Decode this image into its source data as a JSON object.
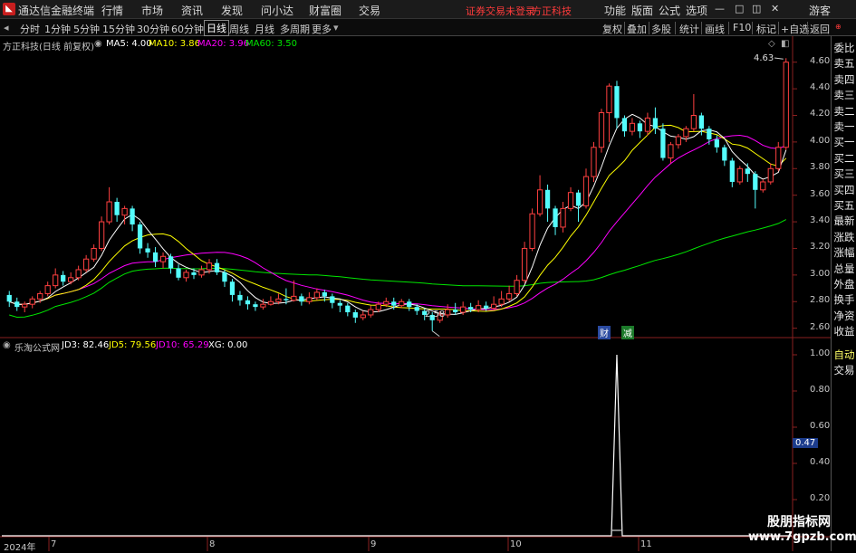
{
  "titlebar": {
    "app_name": "通达信金融终端",
    "menus": [
      "行情",
      "市场",
      "资讯",
      "发现",
      "问小达",
      "财富圈",
      "交易"
    ],
    "warning": "证券交易未登录",
    "broker": "方正科技",
    "right_menus": [
      "功能",
      "版面",
      "公式",
      "选项"
    ],
    "guest": "游客"
  },
  "periodbar": {
    "periods": [
      "分时",
      "1分钟",
      "5分钟",
      "15分钟",
      "30分钟",
      "60分钟",
      "日线",
      "周线",
      "月线",
      "多周期",
      "更多"
    ],
    "active": "日线",
    "tools": [
      "复权",
      "叠加",
      "多股",
      "统计",
      "画线",
      "F10",
      "标记",
      "+自选",
      "返回"
    ]
  },
  "main_legend": {
    "stock": "方正科技(日线 前复权)",
    "ma5": "MA5: 4.00",
    "ma10": "MA10: 3.86",
    "ma20": "MA20: 3.96",
    "ma60": "MA60: 3.50"
  },
  "sub_legend": {
    "name": "乐淘公式网",
    "jd3": "JD3: 82.46",
    "jd5": "JD5: 79.56",
    "jd10": "JD10: 65.29",
    "xg": "XG: 0.00"
  },
  "price_axis": [
    "4.60",
    "4.40",
    "4.20",
    "4.00",
    "3.80",
    "3.60",
    "3.40",
    "3.20",
    "3.00",
    "2.80",
    "2.60"
  ],
  "sub_axis": [
    "1.00",
    "0.80",
    "0.60",
    "0.40",
    "0.20"
  ],
  "sub_cursor_value": "0.47",
  "annotations": {
    "high": "4.63",
    "low": "2.58",
    "cai": "财",
    "jian": "减"
  },
  "date_axis": [
    "2024年",
    "7",
    "8",
    "9",
    "10",
    "11"
  ],
  "right_panel": [
    "委比",
    "卖五",
    "卖四",
    "卖三",
    "卖二",
    "卖一",
    "买一",
    "买二",
    "买三",
    "买四",
    "买五",
    "最新",
    "涨跌",
    "涨幅",
    "总量",
    "外盘",
    "换手",
    "净资",
    "收益"
  ],
  "right_bottom": [
    "自动",
    "交易"
  ],
  "watermark": {
    "cn": "股朋指标网",
    "url": "www.7gpzb.com"
  },
  "colors": {
    "up": "#ff4040",
    "down": "#54fcfc",
    "ma5": "#ffffff",
    "ma10": "#ffff00",
    "ma20": "#ff00ff",
    "ma60": "#00e600",
    "jd_line": "#ffffff"
  },
  "chart_data": {
    "type": "candlestick",
    "y_range": [
      2.55,
      4.7
    ],
    "candles": [
      [
        2.85,
        2.8,
        2.88,
        2.76
      ],
      [
        2.8,
        2.76,
        2.83,
        2.73
      ],
      [
        2.76,
        2.78,
        2.8,
        2.72
      ],
      [
        2.78,
        2.82,
        2.84,
        2.75
      ],
      [
        2.82,
        2.86,
        2.88,
        2.79
      ],
      [
        2.86,
        2.92,
        2.95,
        2.84
      ],
      [
        2.92,
        3.0,
        3.05,
        2.9
      ],
      [
        3.0,
        2.95,
        3.03,
        2.92
      ],
      [
        2.95,
        2.98,
        3.02,
        2.93
      ],
      [
        2.98,
        3.04,
        3.07,
        2.96
      ],
      [
        3.04,
        3.12,
        3.15,
        3.02
      ],
      [
        3.12,
        3.2,
        3.23,
        3.1
      ],
      [
        3.2,
        3.4,
        3.44,
        3.18
      ],
      [
        3.4,
        3.55,
        3.66,
        3.38
      ],
      [
        3.55,
        3.45,
        3.58,
        3.4
      ],
      [
        3.45,
        3.5,
        3.52,
        3.38
      ],
      [
        3.5,
        3.38,
        3.52,
        3.33
      ],
      [
        3.38,
        3.2,
        3.4,
        3.16
      ],
      [
        3.2,
        3.17,
        3.24,
        3.13
      ],
      [
        3.17,
        3.1,
        3.21,
        3.06
      ],
      [
        3.1,
        3.14,
        3.17,
        3.05
      ],
      [
        3.14,
        3.05,
        3.16,
        3.01
      ],
      [
        3.05,
        2.98,
        3.08,
        2.96
      ],
      [
        2.98,
        3.02,
        3.04,
        2.95
      ],
      [
        3.02,
        3.0,
        3.05,
        2.97
      ],
      [
        3.0,
        3.04,
        3.07,
        2.98
      ],
      [
        3.04,
        3.09,
        3.12,
        3.01
      ],
      [
        3.09,
        3.02,
        3.12,
        3.0
      ],
      [
        3.02,
        2.95,
        3.04,
        2.91
      ],
      [
        2.95,
        2.85,
        2.97,
        2.8
      ],
      [
        2.85,
        2.81,
        2.88,
        2.77
      ],
      [
        2.81,
        2.78,
        2.84,
        2.74
      ],
      [
        2.78,
        2.76,
        2.8,
        2.73
      ],
      [
        2.76,
        2.78,
        2.82,
        2.74
      ],
      [
        2.78,
        2.8,
        2.84,
        2.77
      ],
      [
        2.8,
        2.82,
        2.86,
        2.78
      ],
      [
        2.82,
        2.81,
        2.9,
        2.78
      ],
      [
        2.81,
        2.84,
        2.96,
        2.8
      ],
      [
        2.84,
        2.8,
        2.86,
        2.77
      ],
      [
        2.8,
        2.83,
        2.87,
        2.78
      ],
      [
        2.83,
        2.87,
        2.9,
        2.81
      ],
      [
        2.87,
        2.84,
        2.89,
        2.8
      ],
      [
        2.84,
        2.79,
        2.86,
        2.75
      ],
      [
        2.79,
        2.77,
        2.81,
        2.72
      ],
      [
        2.77,
        2.72,
        2.79,
        2.69
      ],
      [
        2.72,
        2.68,
        2.74,
        2.64
      ],
      [
        2.68,
        2.7,
        2.73,
        2.66
      ],
      [
        2.7,
        2.74,
        2.77,
        2.68
      ],
      [
        2.74,
        2.78,
        2.8,
        2.72
      ],
      [
        2.78,
        2.8,
        2.83,
        2.76
      ],
      [
        2.8,
        2.77,
        2.83,
        2.74
      ],
      [
        2.77,
        2.8,
        2.82,
        2.75
      ],
      [
        2.8,
        2.76,
        2.82,
        2.73
      ],
      [
        2.76,
        2.73,
        2.78,
        2.7
      ],
      [
        2.73,
        2.7,
        2.75,
        2.66
      ],
      [
        2.7,
        2.66,
        2.72,
        2.58
      ],
      [
        2.66,
        2.7,
        2.73,
        2.64
      ],
      [
        2.7,
        2.74,
        2.78,
        2.68
      ],
      [
        2.74,
        2.72,
        2.79,
        2.7
      ],
      [
        2.72,
        2.76,
        2.8,
        2.7
      ],
      [
        2.76,
        2.74,
        2.79,
        2.72
      ],
      [
        2.74,
        2.77,
        2.81,
        2.72
      ],
      [
        2.77,
        2.75,
        2.8,
        2.73
      ],
      [
        2.75,
        2.78,
        2.84,
        2.74
      ],
      [
        2.78,
        2.82,
        2.88,
        2.76
      ],
      [
        2.82,
        2.86,
        2.92,
        2.8
      ],
      [
        2.86,
        2.96,
        3.0,
        2.84
      ],
      [
        2.96,
        3.2,
        3.25,
        2.94
      ],
      [
        3.2,
        3.46,
        3.5,
        3.18
      ],
      [
        3.46,
        3.64,
        3.75,
        3.44
      ],
      [
        3.64,
        3.5,
        3.68,
        3.4
      ],
      [
        3.5,
        3.36,
        3.52,
        3.3
      ],
      [
        3.36,
        3.5,
        3.55,
        3.32
      ],
      [
        3.5,
        3.62,
        3.66,
        3.48
      ],
      [
        3.62,
        3.52,
        3.64,
        3.4
      ],
      [
        3.52,
        3.74,
        3.8,
        3.5
      ],
      [
        3.74,
        3.96,
        4.0,
        3.7
      ],
      [
        3.96,
        4.22,
        4.25,
        3.92
      ],
      [
        4.22,
        4.42,
        4.44,
        4.0
      ],
      [
        4.42,
        4.18,
        4.46,
        4.1
      ],
      [
        4.18,
        4.08,
        4.2,
        4.04
      ],
      [
        4.08,
        4.14,
        4.18,
        4.05
      ],
      [
        4.14,
        4.08,
        4.16,
        4.03
      ],
      [
        4.08,
        4.18,
        4.22,
        4.05
      ],
      [
        4.18,
        4.1,
        4.26,
        4.06
      ],
      [
        4.1,
        3.88,
        4.14,
        3.86
      ],
      [
        3.88,
        3.98,
        4.0,
        3.84
      ],
      [
        3.98,
        4.04,
        4.06,
        3.95
      ],
      [
        4.04,
        4.1,
        4.12,
        4.0
      ],
      [
        4.1,
        4.2,
        4.36,
        4.08
      ],
      [
        4.2,
        4.1,
        4.22,
        4.05
      ],
      [
        4.1,
        4.02,
        4.12,
        3.98
      ],
      [
        4.02,
        3.96,
        4.05,
        3.92
      ],
      [
        3.96,
        3.86,
        3.98,
        3.82
      ],
      [
        3.86,
        3.7,
        3.88,
        3.66
      ],
      [
        3.7,
        3.8,
        3.82,
        3.68
      ],
      [
        3.8,
        3.76,
        3.84,
        3.7
      ],
      [
        3.76,
        3.64,
        3.78,
        3.5
      ],
      [
        3.64,
        3.7,
        3.72,
        3.62
      ],
      [
        3.7,
        3.8,
        3.84,
        3.68
      ],
      [
        3.8,
        3.96,
        4.0,
        3.78
      ],
      [
        3.96,
        4.6,
        4.63,
        3.94
      ]
    ],
    "jd_values": "zero except a single spike to 1.00 at bar 79",
    "spike_index": 79
  }
}
